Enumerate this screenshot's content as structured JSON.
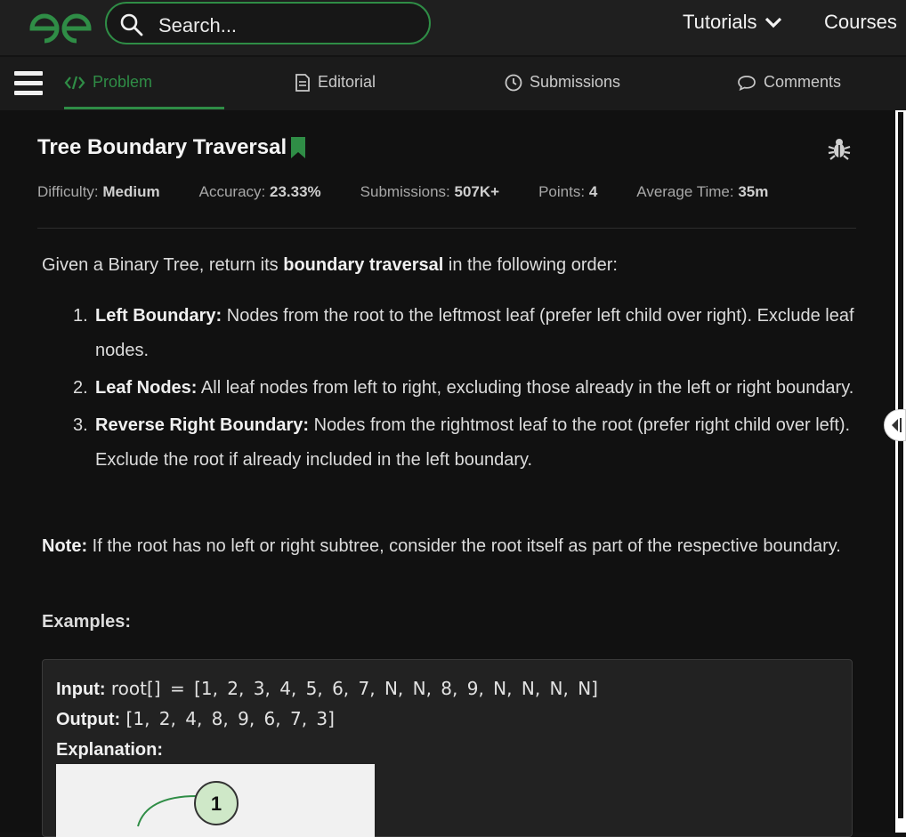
{
  "header": {
    "logo_icon": "gfg-logo-icon",
    "search_placeholder": "Search...",
    "tutorials_label": "Tutorials",
    "courses_label": "Courses",
    "brand_color": "#2f8d46"
  },
  "tabs": [
    {
      "label": "Problem",
      "icon": "code-icon",
      "active": true
    },
    {
      "label": "Editorial",
      "icon": "document-icon",
      "active": false
    },
    {
      "label": "Submissions",
      "icon": "clock-icon",
      "active": false
    },
    {
      "label": "Comments",
      "icon": "chat-icon",
      "active": false
    }
  ],
  "problem": {
    "title": "Tree Boundary Traversal",
    "difficulty_label": "Difficulty:",
    "difficulty_value": "Medium",
    "accuracy_label": "Accuracy:",
    "accuracy_value": "23.33%",
    "submissions_label": "Submissions:",
    "submissions_value": "507K+",
    "points_label": "Points:",
    "points_value": "4",
    "avg_time_label": "Average Time:",
    "avg_time_value": "35m",
    "intro_pre": "Given a Binary Tree, return its ",
    "intro_bold": "boundary traversal",
    "intro_post": " in the following order:",
    "list": [
      {
        "num": "1.",
        "bold": "Left Boundary:",
        "text": " Nodes from the root to the leftmost leaf (prefer left child over right). Exclude leaf nodes."
      },
      {
        "num": "2.",
        "bold": "Leaf Nodes:",
        "text": " All leaf nodes from left to right, excluding those already in the left or right boundary."
      },
      {
        "num": "3.",
        "bold": "Reverse Right Boundary:",
        "text": " Nodes from the rightmost leaf to the root (prefer right child over left). Exclude the root if already included in the left boundary."
      }
    ],
    "note_bold": "Note:",
    "note_text": " If the root has no left or right subtree, consider the root itself as part of the respective boundary.",
    "examples_label": "Examples:",
    "example": {
      "input_label": "Input:",
      "input_value": "root[] = [1, 2, 3, 4, 5, 6, 7, N, N, 8, 9, N, N, N, N]",
      "output_label": "Output:",
      "output_value": "[1, 2, 4, 8, 9, 6, 7, 3]",
      "explanation_label": "Explanation:",
      "tree_root": "1"
    }
  }
}
